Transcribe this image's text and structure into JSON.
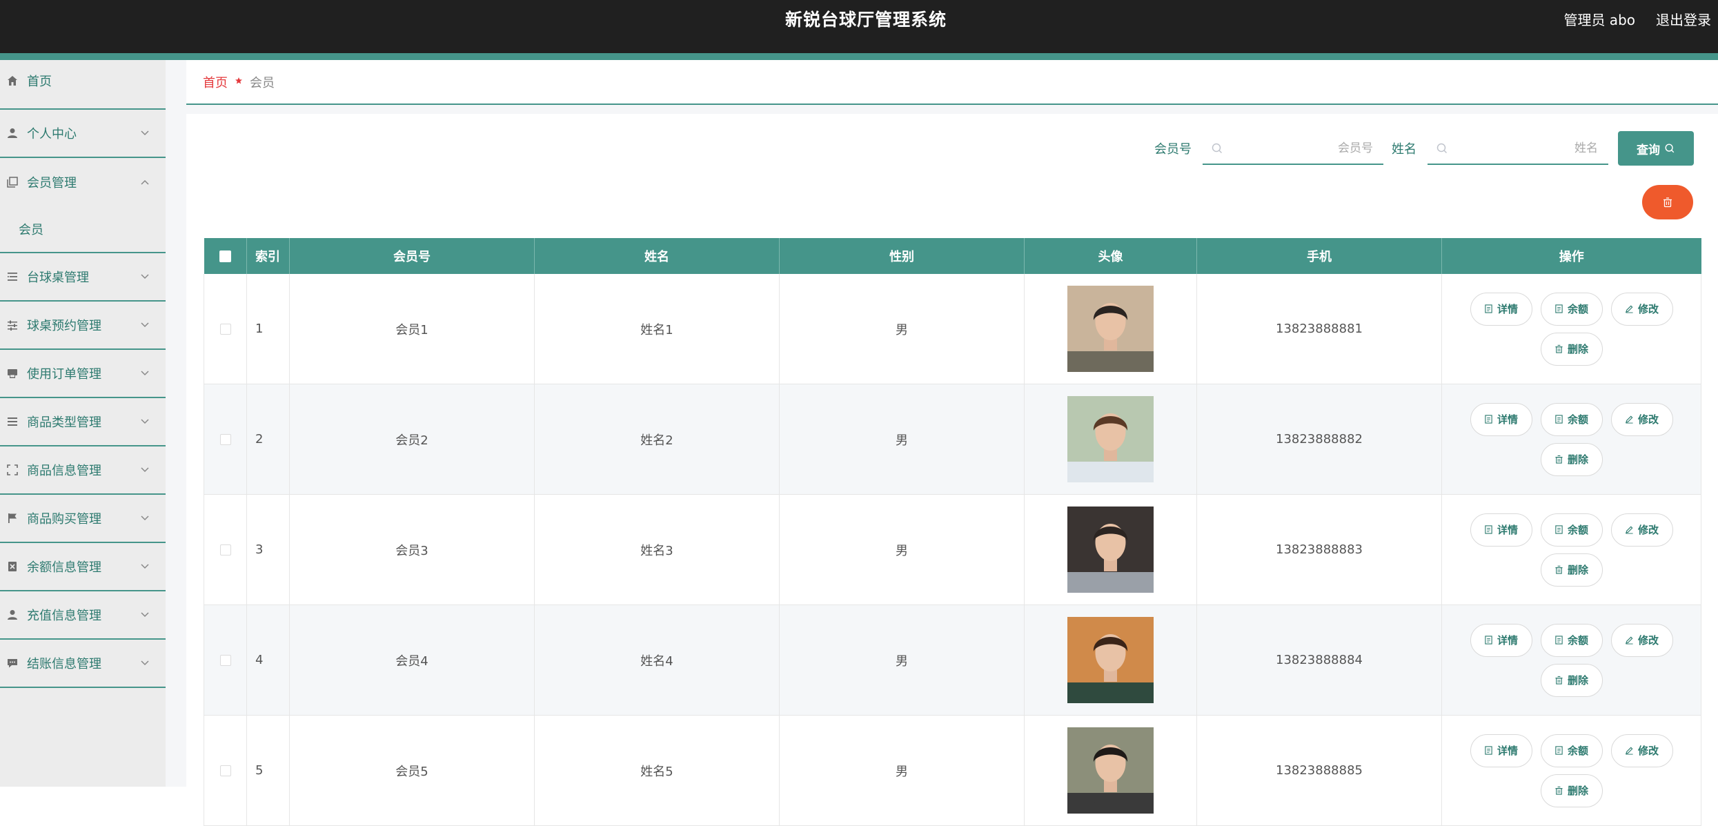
{
  "header": {
    "title": "新锐台球厅管理系统",
    "user_label": "管理员 abo",
    "logout_label": "退出登录",
    "accent_color": "#45958a"
  },
  "sidebar": {
    "items": [
      {
        "label": "首页",
        "icon": "home-icon"
      },
      {
        "label": "个人中心",
        "icon": "user-icon"
      },
      {
        "label": "会员管理",
        "icon": "copy-icon",
        "expanded": true,
        "children": [
          {
            "label": "会员"
          }
        ]
      },
      {
        "label": "台球桌管理",
        "icon": "list-icon"
      },
      {
        "label": "球桌预约管理",
        "icon": "sliders-icon"
      },
      {
        "label": "使用订单管理",
        "icon": "printer-icon"
      },
      {
        "label": "商品类型管理",
        "icon": "menu-icon"
      },
      {
        "label": "商品信息管理",
        "icon": "fullscreen-icon"
      },
      {
        "label": "商品购买管理",
        "icon": "flag-icon"
      },
      {
        "label": "余额信息管理",
        "icon": "delete-box-icon"
      },
      {
        "label": "充值信息管理",
        "icon": "user-icon"
      },
      {
        "label": "结账信息管理",
        "icon": "chat-icon"
      }
    ]
  },
  "breadcrumb": {
    "home": "首页",
    "current": "会员"
  },
  "search": {
    "member_no_label": "会员号",
    "member_no_placeholder": "会员号",
    "name_label": "姓名",
    "name_placeholder": "姓名",
    "query_label": "查询"
  },
  "table": {
    "headers": {
      "index": "索引",
      "member_no": "会员号",
      "name": "姓名",
      "gender": "性别",
      "avatar": "头像",
      "phone": "手机",
      "actions": "操作"
    },
    "actions": {
      "detail": "详情",
      "balance": "余额",
      "edit": "修改",
      "delete": "删除"
    },
    "rows": [
      {
        "index": "1",
        "member_no": "会员1",
        "name": "姓名1",
        "gender": "男",
        "phone": "13823888881"
      },
      {
        "index": "2",
        "member_no": "会员2",
        "name": "姓名2",
        "gender": "男",
        "phone": "13823888882"
      },
      {
        "index": "3",
        "member_no": "会员3",
        "name": "姓名3",
        "gender": "男",
        "phone": "13823888883"
      },
      {
        "index": "4",
        "member_no": "会员4",
        "name": "姓名4",
        "gender": "男",
        "phone": "13823888884"
      },
      {
        "index": "5",
        "member_no": "会员5",
        "name": "姓名5",
        "gender": "男",
        "phone": "13823888885"
      }
    ]
  }
}
